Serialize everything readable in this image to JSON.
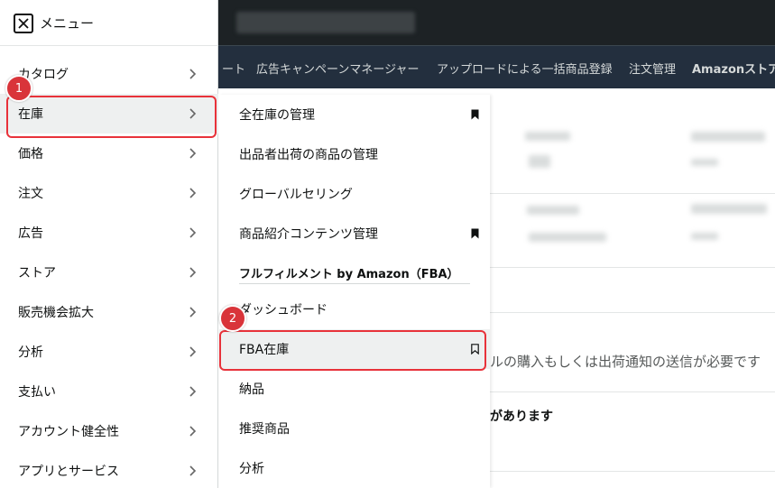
{
  "menu": {
    "title": "メニュー",
    "items": [
      {
        "label": "カタログ"
      },
      {
        "label": "在庫"
      },
      {
        "label": "価格"
      },
      {
        "label": "注文"
      },
      {
        "label": "広告"
      },
      {
        "label": "ストア"
      },
      {
        "label": "販売機会拡大"
      },
      {
        "label": "分析"
      },
      {
        "label": "支払い"
      },
      {
        "label": "アカウント健全性"
      },
      {
        "label": "アプリとサービス"
      }
    ]
  },
  "submenu": {
    "items": [
      {
        "label": "全在庫の管理",
        "bookmarked": true
      },
      {
        "label": "出品者出荷の商品の管理",
        "bookmarked": false
      },
      {
        "label": "グローバルセリング",
        "bookmarked": false
      },
      {
        "label": "商品紹介コンテンツ管理",
        "bookmarked": true
      }
    ],
    "section_header": "フルフィルメント by Amazon（FBA）",
    "fba_items": [
      {
        "label": "ダッシュボード",
        "bookmarked": false
      },
      {
        "label": "FBA在庫",
        "bookmarked": false
      },
      {
        "label": "納品",
        "bookmarked": false
      },
      {
        "label": "推奨商品",
        "bookmarked": false
      },
      {
        "label": "分析",
        "bookmarked": false
      }
    ]
  },
  "navbar": {
    "items": [
      "ート",
      "広告キャンペーンマネージャー",
      "アップロードによる一括商品登録",
      "注文管理",
      "Amazonストア"
    ]
  },
  "background": {
    "notice_text": "ルの購入もしくは出荷通知の送信が必要です",
    "bold_text": "があります"
  },
  "annotations": {
    "step1": "1",
    "step2": "2"
  },
  "colors": {
    "highlight": "#e8323a",
    "topbar": "#1d2225",
    "navbar": "#232f3e"
  }
}
